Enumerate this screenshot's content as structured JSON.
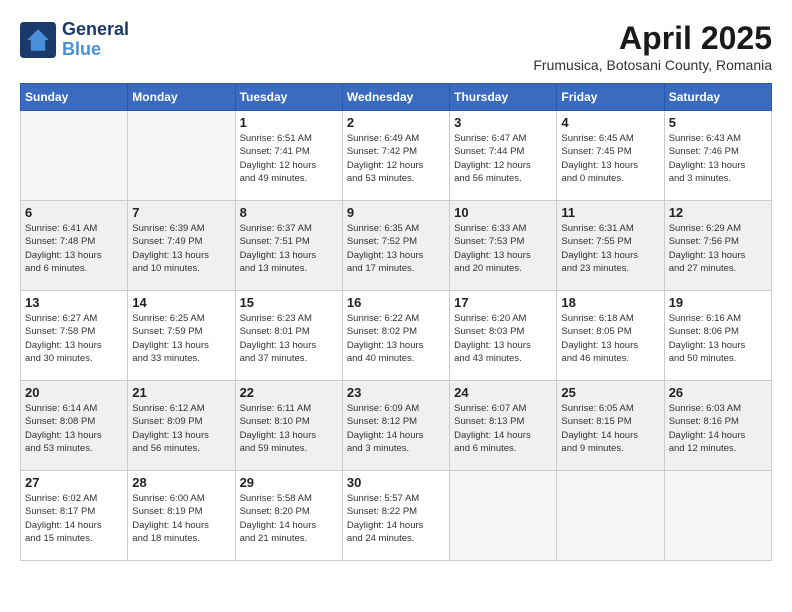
{
  "header": {
    "logo_line1": "General",
    "logo_line2": "Blue",
    "month_title": "April 2025",
    "subtitle": "Frumusica, Botosani County, Romania"
  },
  "days_of_week": [
    "Sunday",
    "Monday",
    "Tuesday",
    "Wednesday",
    "Thursday",
    "Friday",
    "Saturday"
  ],
  "weeks": [
    [
      {
        "day": "",
        "info": ""
      },
      {
        "day": "",
        "info": ""
      },
      {
        "day": "1",
        "info": "Sunrise: 6:51 AM\nSunset: 7:41 PM\nDaylight: 12 hours\nand 49 minutes."
      },
      {
        "day": "2",
        "info": "Sunrise: 6:49 AM\nSunset: 7:42 PM\nDaylight: 12 hours\nand 53 minutes."
      },
      {
        "day": "3",
        "info": "Sunrise: 6:47 AM\nSunset: 7:44 PM\nDaylight: 12 hours\nand 56 minutes."
      },
      {
        "day": "4",
        "info": "Sunrise: 6:45 AM\nSunset: 7:45 PM\nDaylight: 13 hours\nand 0 minutes."
      },
      {
        "day": "5",
        "info": "Sunrise: 6:43 AM\nSunset: 7:46 PM\nDaylight: 13 hours\nand 3 minutes."
      }
    ],
    [
      {
        "day": "6",
        "info": "Sunrise: 6:41 AM\nSunset: 7:48 PM\nDaylight: 13 hours\nand 6 minutes."
      },
      {
        "day": "7",
        "info": "Sunrise: 6:39 AM\nSunset: 7:49 PM\nDaylight: 13 hours\nand 10 minutes."
      },
      {
        "day": "8",
        "info": "Sunrise: 6:37 AM\nSunset: 7:51 PM\nDaylight: 13 hours\nand 13 minutes."
      },
      {
        "day": "9",
        "info": "Sunrise: 6:35 AM\nSunset: 7:52 PM\nDaylight: 13 hours\nand 17 minutes."
      },
      {
        "day": "10",
        "info": "Sunrise: 6:33 AM\nSunset: 7:53 PM\nDaylight: 13 hours\nand 20 minutes."
      },
      {
        "day": "11",
        "info": "Sunrise: 6:31 AM\nSunset: 7:55 PM\nDaylight: 13 hours\nand 23 minutes."
      },
      {
        "day": "12",
        "info": "Sunrise: 6:29 AM\nSunset: 7:56 PM\nDaylight: 13 hours\nand 27 minutes."
      }
    ],
    [
      {
        "day": "13",
        "info": "Sunrise: 6:27 AM\nSunset: 7:58 PM\nDaylight: 13 hours\nand 30 minutes."
      },
      {
        "day": "14",
        "info": "Sunrise: 6:25 AM\nSunset: 7:59 PM\nDaylight: 13 hours\nand 33 minutes."
      },
      {
        "day": "15",
        "info": "Sunrise: 6:23 AM\nSunset: 8:01 PM\nDaylight: 13 hours\nand 37 minutes."
      },
      {
        "day": "16",
        "info": "Sunrise: 6:22 AM\nSunset: 8:02 PM\nDaylight: 13 hours\nand 40 minutes."
      },
      {
        "day": "17",
        "info": "Sunrise: 6:20 AM\nSunset: 8:03 PM\nDaylight: 13 hours\nand 43 minutes."
      },
      {
        "day": "18",
        "info": "Sunrise: 6:18 AM\nSunset: 8:05 PM\nDaylight: 13 hours\nand 46 minutes."
      },
      {
        "day": "19",
        "info": "Sunrise: 6:16 AM\nSunset: 8:06 PM\nDaylight: 13 hours\nand 50 minutes."
      }
    ],
    [
      {
        "day": "20",
        "info": "Sunrise: 6:14 AM\nSunset: 8:08 PM\nDaylight: 13 hours\nand 53 minutes."
      },
      {
        "day": "21",
        "info": "Sunrise: 6:12 AM\nSunset: 8:09 PM\nDaylight: 13 hours\nand 56 minutes."
      },
      {
        "day": "22",
        "info": "Sunrise: 6:11 AM\nSunset: 8:10 PM\nDaylight: 13 hours\nand 59 minutes."
      },
      {
        "day": "23",
        "info": "Sunrise: 6:09 AM\nSunset: 8:12 PM\nDaylight: 14 hours\nand 3 minutes."
      },
      {
        "day": "24",
        "info": "Sunrise: 6:07 AM\nSunset: 8:13 PM\nDaylight: 14 hours\nand 6 minutes."
      },
      {
        "day": "25",
        "info": "Sunrise: 6:05 AM\nSunset: 8:15 PM\nDaylight: 14 hours\nand 9 minutes."
      },
      {
        "day": "26",
        "info": "Sunrise: 6:03 AM\nSunset: 8:16 PM\nDaylight: 14 hours\nand 12 minutes."
      }
    ],
    [
      {
        "day": "27",
        "info": "Sunrise: 6:02 AM\nSunset: 8:17 PM\nDaylight: 14 hours\nand 15 minutes."
      },
      {
        "day": "28",
        "info": "Sunrise: 6:00 AM\nSunset: 8:19 PM\nDaylight: 14 hours\nand 18 minutes."
      },
      {
        "day": "29",
        "info": "Sunrise: 5:58 AM\nSunset: 8:20 PM\nDaylight: 14 hours\nand 21 minutes."
      },
      {
        "day": "30",
        "info": "Sunrise: 5:57 AM\nSunset: 8:22 PM\nDaylight: 14 hours\nand 24 minutes."
      },
      {
        "day": "",
        "info": ""
      },
      {
        "day": "",
        "info": ""
      },
      {
        "day": "",
        "info": ""
      }
    ]
  ]
}
